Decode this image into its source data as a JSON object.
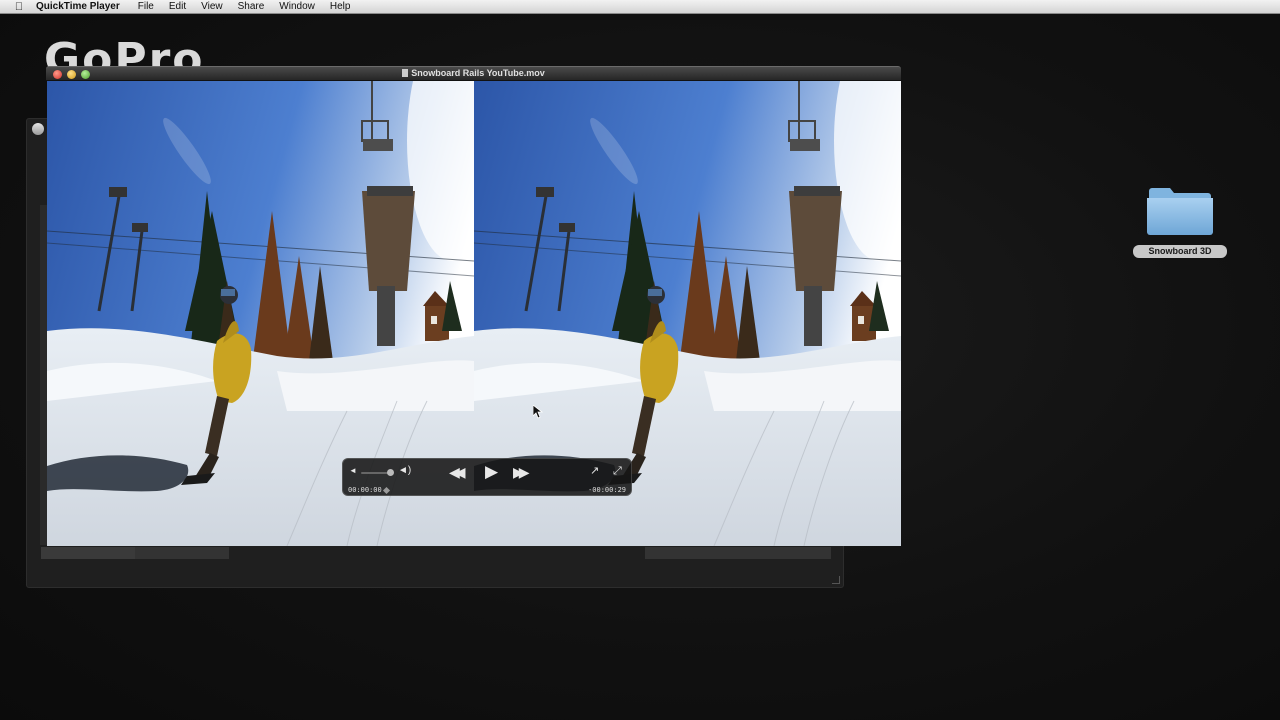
{
  "menubar": {
    "apple_icon": "apple-logo-icon",
    "app_name": "QuickTime Player",
    "items": [
      "File",
      "Edit",
      "View",
      "Share",
      "Window",
      "Help"
    ]
  },
  "background": {
    "logo_text": "GoPro"
  },
  "window": {
    "title": "Snowboard Rails YouTube.mov",
    "file_icon": "movie-file-icon"
  },
  "player": {
    "current_time": "00:00:00",
    "remaining_time": "-00:00:29",
    "volume_level": 0.8,
    "playhead_fraction": 0.0,
    "icons": {
      "volume_low": "speaker-low-icon",
      "volume_high": "speaker-high-icon",
      "rewind": "rewind-icon",
      "play": "play-icon",
      "fast_forward": "fast-forward-icon",
      "share": "share-icon",
      "fullscreen": "fullscreen-icon"
    }
  },
  "desktop": {
    "folder_label": "Snowboard 3D",
    "folder_icon": "folder-icon"
  }
}
